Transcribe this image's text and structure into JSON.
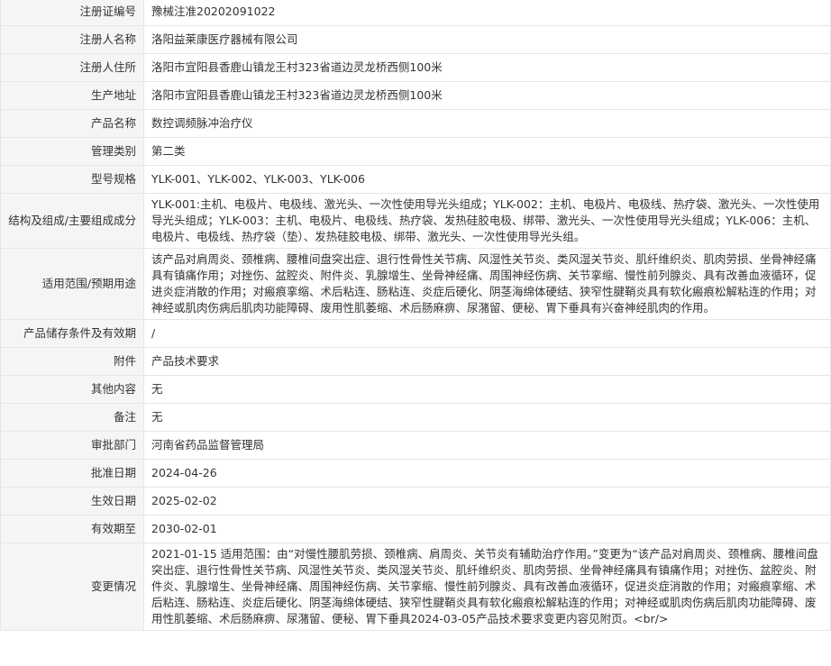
{
  "rows": [
    {
      "label": "注册证编号",
      "value": "豫械注准20202091022"
    },
    {
      "label": "注册人名称",
      "value": "洛阳益莱康医疗器械有限公司"
    },
    {
      "label": "注册人住所",
      "value": "洛阳市宜阳县香鹿山镇龙王村323省道边灵龙桥西侧100米"
    },
    {
      "label": "生产地址",
      "value": "洛阳市宜阳县香鹿山镇龙王村323省道边灵龙桥西侧100米"
    },
    {
      "label": "产品名称",
      "value": "数控调频脉冲治疗仪"
    },
    {
      "label": "管理类别",
      "value": "第二类"
    },
    {
      "label": "型号规格",
      "value": "YLK-001、YLK-002、YLK-003、YLK-006"
    },
    {
      "label": "结构及组成/主要组成成分",
      "value": "YLK-001:主机、电极片、电极线、激光头、一次性使用导光头组成；YLK-002：主机、电极片、电极线、热疗袋、激光头、一次性使用导光头组成；YLK-003：主机、电极片、电极线、热疗袋、发热硅胶电极、绑带、激光头、一次性使用导光头组成；YLK-006：主机、电极片、电极线、热疗袋（垫）、发热硅胶电极、绑带、激光头、一次性使用导光头组。"
    },
    {
      "label": "适用范围/预期用途",
      "value": "该产品对肩周炎、颈椎病、腰椎间盘突出症、退行性骨性关节病、风湿性关节炎、类风湿关节炎、肌纤维织炎、肌肉劳损、坐骨神经痛具有镇痛作用；对挫伤、盆腔炎、附件炎、乳腺增生、坐骨神经痛、周围神经伤病、关节挛缩、慢性前列腺炎、具有改善血液循环，促进炎症消散的作用；对瘢痕挛缩、术后粘连、肠粘连、炎症后硬化、阴茎海绵体硬结、狭窄性腱鞘炎具有软化瘢痕松解粘连的作用；对神经或肌肉伤病后肌肉功能障碍、废用性肌萎缩、术后肠麻痹、尿潴留、便秘、胃下垂具有兴奋神经肌肉的作用。"
    },
    {
      "label": "产品储存条件及有效期",
      "value": "/"
    },
    {
      "label": "附件",
      "value": "产品技术要求"
    },
    {
      "label": "其他内容",
      "value": "无"
    },
    {
      "label": "备注",
      "value": "无"
    },
    {
      "label": "审批部门",
      "value": "河南省药品监督管理局"
    },
    {
      "label": "批准日期",
      "value": "2024-04-26"
    },
    {
      "label": "生效日期",
      "value": "2025-02-02"
    },
    {
      "label": "有效期至",
      "value": "2030-02-01"
    },
    {
      "label": "变更情况",
      "value": "2021-01-15 适用范围：由“对慢性腰肌劳损、颈椎病、肩周炎、关节炎有辅助治疗作用。”变更为“该产品对肩周炎、颈椎病、腰椎间盘突出症、退行性骨性关节病、风湿性关节炎、类风湿关节炎、肌纤维织炎、肌肉劳损、坐骨神经痛具有镇痛作用；对挫伤、盆腔炎、附件炎、乳腺增生、坐骨神经痛、周围神经伤病、关节挛缩、慢性前列腺炎、具有改善血液循环，促进炎症消散的作用；对瘢痕挛缩、术后粘连、肠粘连、炎症后硬化、阴茎海绵体硬结、狭窄性腱鞘炎具有软化瘢痕松解粘连的作用；对神经或肌肉伤病后肌肉功能障碍、废用性肌萎缩、术后肠麻痹、尿潴留、便秘、胃下垂具2024-03-05产品技术要求变更内容见附页。<br/>"
    }
  ]
}
